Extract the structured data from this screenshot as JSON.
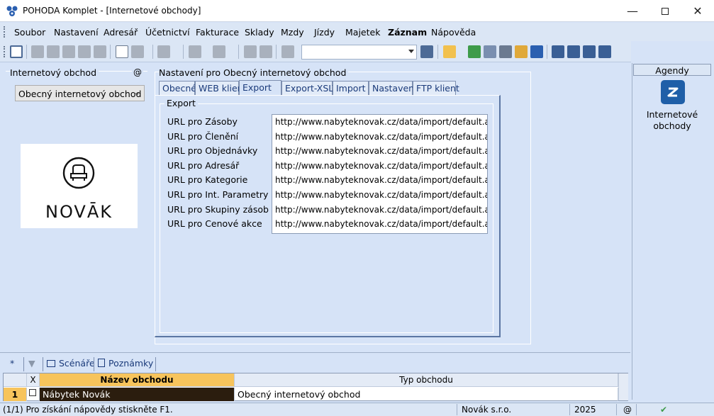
{
  "window": {
    "title": "POHODA Komplet - [Internetové obchody]"
  },
  "menu": [
    "Soubor",
    "Nastavení",
    "Adresář",
    "Účetnictví",
    "Fakturace",
    "Sklady",
    "Mzdy",
    "Jízdy",
    "Majetek",
    "Záznam",
    "Nápověda"
  ],
  "left_panel": {
    "title": "Internetový obchod",
    "at_symbol": "@",
    "select_value": "Obecný internetový obchod",
    "logo_text": "NOVĀK"
  },
  "settings": {
    "title": "Nastavení pro Obecný internetový obchod",
    "tabs": [
      "Obecné",
      "WEB klient",
      "Export",
      "Export-XSLT",
      "Import",
      "Nastavení",
      "FTP klient"
    ],
    "active_tab": "Export",
    "group_title": "Export",
    "rows": [
      {
        "label": "URL pro Zásoby",
        "value": "http://www.nabyteknovak.cz/data/import/default.ash?ag"
      },
      {
        "label": "URL pro Členění",
        "value": "http://www.nabyteknovak.cz/data/import/default.ash?ag"
      },
      {
        "label": "URL pro Objednávky",
        "value": "http://www.nabyteknovak.cz/data/import/default.ash?ag"
      },
      {
        "label": "URL pro Adresář",
        "value": "http://www.nabyteknovak.cz/data/import/default.ash?ag"
      },
      {
        "label": "URL pro Kategorie",
        "value": "http://www.nabyteknovak.cz/data/import/default.ash?ag"
      },
      {
        "label": "URL pro Int. Parametry",
        "value": "http://www.nabyteknovak.cz/data/import/default.ash?ag"
      },
      {
        "label": "URL pro Skupiny zásob",
        "value": "http://www.nabyteknovak.cz/data/import/default.ash?ag"
      },
      {
        "label": "URL pro Cenové akce",
        "value": "http://www.nabyteknovak.cz/data/import/default.ash?ag"
      }
    ]
  },
  "agenda": {
    "header": "Agendy",
    "item_label": "Internetové obchody"
  },
  "bottom": {
    "tabs": {
      "star": "*",
      "scenare": "Scénáře",
      "poznamky": "Poznámky"
    },
    "columns": {
      "x": "X",
      "name": "Název obchodu",
      "type": "Typ obchodu"
    },
    "rows": [
      {
        "index": "1",
        "name": "Nábytek Novák",
        "type": "Obecný internetový obchod"
      }
    ]
  },
  "status": {
    "help": "(1/1) Pro získání nápovědy stiskněte F1.",
    "company": "Novák s.r.o.",
    "year": "2025",
    "at": "@"
  },
  "colors": {
    "accent_blue": "#1f5fa8",
    "sorted_header": "#f7c45c",
    "selected_row": "#2b1d0e"
  }
}
